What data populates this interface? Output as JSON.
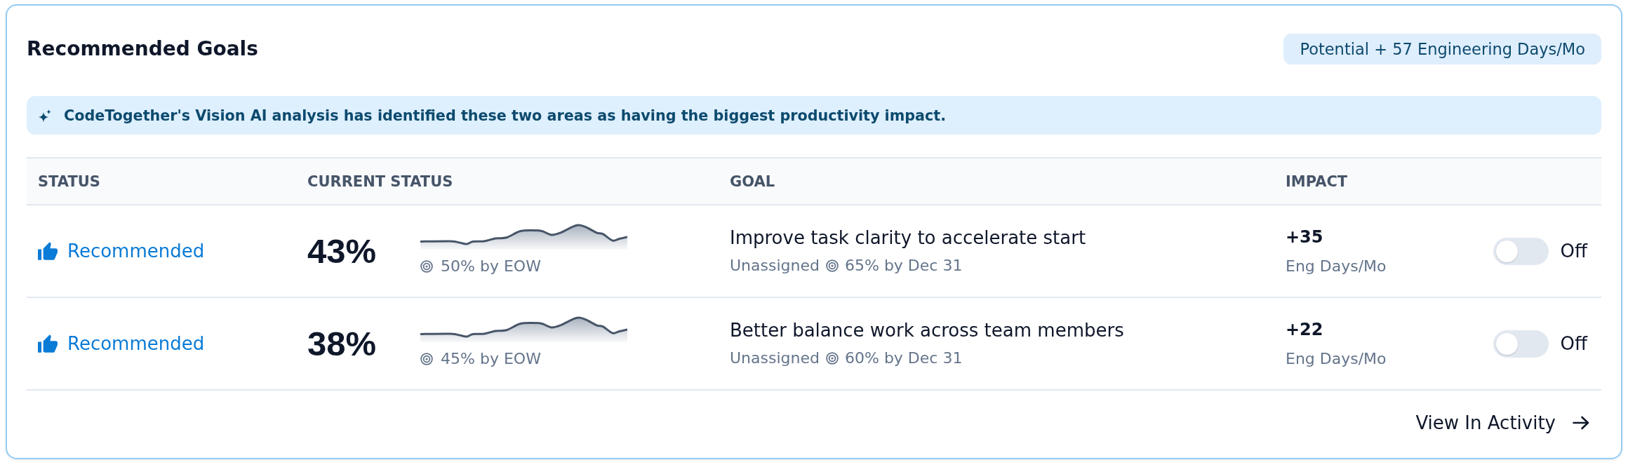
{
  "card": {
    "title": "Recommended Goals",
    "badge": "Potential + 57 Engineering Days/Mo"
  },
  "banner": {
    "text": "CodeTogether's Vision AI analysis has identified these two areas as having the biggest productivity impact."
  },
  "table": {
    "columns": [
      "STATUS",
      "CURRENT STATUS",
      "GOAL",
      "IMPACT"
    ],
    "rows": [
      {
        "status": "Recommended",
        "current": "43%",
        "weekly_target": "50% by EOW",
        "goal": "Improve task clarity to accelerate start",
        "assignee": "Unassigned",
        "goal_target": "65% by Dec 31",
        "impact": "+35",
        "impact_unit": "Eng Days/Mo",
        "toggle": {
          "on": false,
          "label": "Off"
        }
      },
      {
        "status": "Recommended",
        "current": "38%",
        "weekly_target": "45% by EOW",
        "goal": "Better balance work across team members",
        "assignee": "Unassigned",
        "goal_target": "60% by Dec 31",
        "impact": "+22",
        "impact_unit": "Eng Days/Mo",
        "toggle": {
          "on": false,
          "label": "Off"
        }
      }
    ]
  },
  "footer": {
    "link": "View In Activity"
  }
}
